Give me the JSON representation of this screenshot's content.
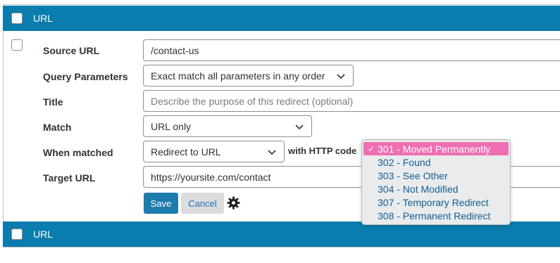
{
  "header": {
    "title": "URL"
  },
  "footer": {
    "title": "URL"
  },
  "form": {
    "source_url": {
      "label": "Source URL",
      "value": "/contact-us"
    },
    "query_params": {
      "label": "Query Parameters",
      "value": "Exact match all parameters in any order"
    },
    "title": {
      "label": "Title",
      "placeholder": "Describe the purpose of this redirect (optional)"
    },
    "match": {
      "label": "Match",
      "value": "URL only"
    },
    "when_matched": {
      "label": "When matched",
      "value": "Redirect to URL",
      "http_code_label": "with HTTP code"
    },
    "target_url": {
      "label": "Target URL",
      "value": "https://yoursite.com/contact"
    }
  },
  "buttons": {
    "save": "Save",
    "cancel": "Cancel"
  },
  "http_codes": {
    "selected": "301 - Moved Permanently",
    "check": "✓",
    "options": [
      "301 - Moved Permanently",
      "302 - Found",
      "303 - See Other",
      "304 - Not Modified",
      "307 - Temporary Redirect",
      "308 - Permanent Redirect"
    ]
  },
  "colors": {
    "accent": "#0a7cad",
    "highlight": "#f06fb3"
  }
}
